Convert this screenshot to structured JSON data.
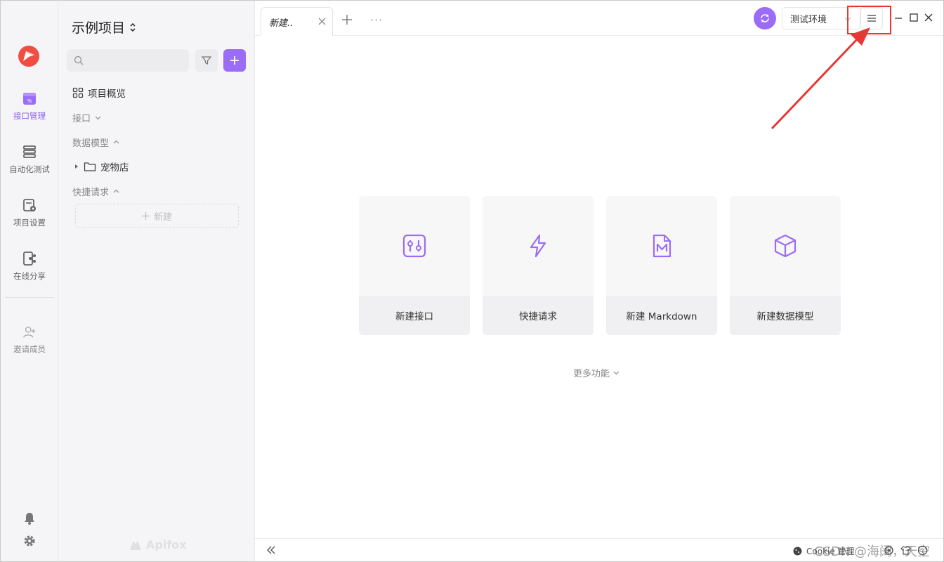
{
  "app": {
    "project_title": "示例项目",
    "brand_name": "Apifox"
  },
  "rail": {
    "items": [
      {
        "label": "接口管理",
        "icon": "api-icon",
        "active": true
      },
      {
        "label": "自动化测试",
        "icon": "automation-icon",
        "active": false
      },
      {
        "label": "项目设置",
        "icon": "settings-doc-icon",
        "active": false
      },
      {
        "label": "在线分享",
        "icon": "share-icon",
        "active": false
      }
    ],
    "invite_label": "邀请成员"
  },
  "tree": {
    "search_placeholder": "",
    "overview_label": "项目概览",
    "sections": [
      {
        "label": "接口",
        "expanded": false
      },
      {
        "label": "数据模型",
        "expanded": true
      },
      {
        "label": "快捷请求",
        "expanded": true
      }
    ],
    "folder_label": "宠物店",
    "new_label": "新建"
  },
  "tabs": [
    {
      "label": "新建..",
      "active": true
    }
  ],
  "toolbar": {
    "environment": "测试环境"
  },
  "cards": [
    {
      "label": "新建接口",
      "icon": "api-icon"
    },
    {
      "label": "快捷请求",
      "icon": "lightning-icon"
    },
    {
      "label": "新建 Markdown",
      "icon": "markdown-file-icon"
    },
    {
      "label": "新建数据模型",
      "icon": "cube-icon"
    }
  ],
  "more_functions": "更多功能",
  "status": {
    "cookie_label": "Cookie 管理"
  },
  "watermark": "CSDN @海阔，天空",
  "colors": {
    "accent": "#9b6cf6",
    "highlight": "#e53935"
  }
}
